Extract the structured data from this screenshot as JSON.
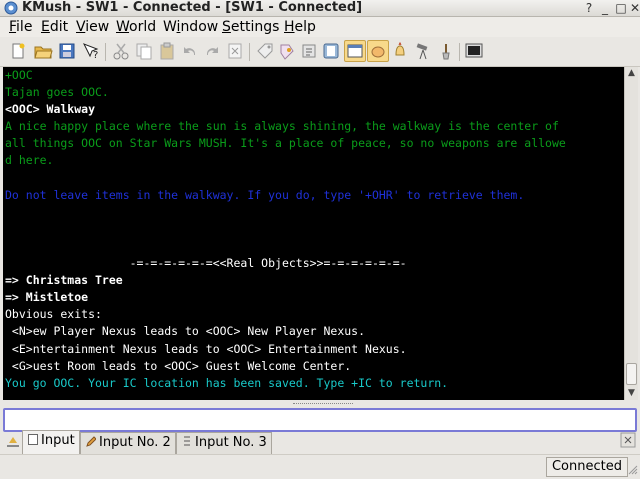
{
  "window": {
    "title": "KMush - SW1 - Connected - [SW1 - Connected]"
  },
  "menu": [
    {
      "label": "File",
      "key": "F",
      "rest": "ile"
    },
    {
      "label": "Edit",
      "key": "E",
      "rest": "dit"
    },
    {
      "label": "View",
      "key": "V",
      "rest": "iew"
    },
    {
      "label": "World",
      "key": "W",
      "rest": "orld"
    },
    {
      "label": "Window",
      "key": "i",
      "pre": "W",
      "rest": "ndow"
    },
    {
      "label": "Settings",
      "key": "S",
      "rest": "ettings"
    },
    {
      "label": "Help",
      "key": "H",
      "rest": "elp"
    }
  ],
  "toolbar": {
    "icons": [
      "new-icon",
      "open-icon",
      "save-icon",
      "whats-this-icon",
      "cut-icon",
      "copy-icon",
      "paste-icon",
      "undo-icon",
      "redo-icon",
      "clear-icon",
      "tag-icon",
      "filter-icon",
      "script-icon",
      "log-icon",
      "window-icon",
      "hand-icon",
      "bell-icon",
      "telescope-icon",
      "brush-icon",
      "console-icon"
    ]
  },
  "terminal": {
    "lines": [
      {
        "text": "+OOC",
        "color": "grn"
      },
      {
        "text": "Tajan goes OOC.",
        "color": "grn"
      },
      {
        "text": "<OOC> Walkway",
        "color": "wb"
      },
      {
        "text": "A nice happy place where the sun is always shining, the walkway is the center of",
        "color": "grn"
      },
      {
        "text": "all things OOC on Star Wars MUSH. It's a place of peace, so no weapons are allowe",
        "color": "grn"
      },
      {
        "text": "d here.",
        "color": "grn"
      },
      {
        "text": "",
        "color": "grn"
      },
      {
        "text": "Do not leave items in the walkway. If you do, type '+OHR' to retrieve them.",
        "color": "blu"
      },
      {
        "text": "",
        "color": "grn"
      },
      {
        "text": "",
        "color": "grn"
      },
      {
        "text": "",
        "color": "grn"
      },
      {
        "text": "                  -=-=-=-=-=-=<<Real Objects>>=-=-=-=-=-=-",
        "color": "wht"
      },
      {
        "text": "=> Christmas Tree",
        "color": "wb"
      },
      {
        "text": "=> Mistletoe",
        "color": "wb"
      },
      {
        "text": "Obvious exits:",
        "color": "wht"
      },
      {
        "text": " <N>ew Player Nexus leads to <OOC> New Player Nexus.",
        "color": "wht"
      },
      {
        "text": " <E>ntertainment Nexus leads to <OOC> Entertainment Nexus.",
        "color": "wht"
      },
      {
        "text": " <G>uest Room leads to <OOC> Guest Welcome Center.",
        "color": "wht"
      },
      {
        "text": "You go OOC. Your IC location has been saved. Type +IC to return.",
        "color": "cyn"
      }
    ]
  },
  "input": {
    "value": ""
  },
  "tabs": [
    {
      "label": "Input",
      "active": true
    },
    {
      "label": "Input No. 2",
      "active": false
    },
    {
      "label": "Input No. 3",
      "active": false
    }
  ],
  "status": {
    "text": "Connected"
  },
  "colors": {
    "accent": "#7a7ad6",
    "terminal_bg": "#000000",
    "green": "#0a9d1a",
    "blue": "#1f31d8",
    "cyan": "#19c9c9"
  }
}
